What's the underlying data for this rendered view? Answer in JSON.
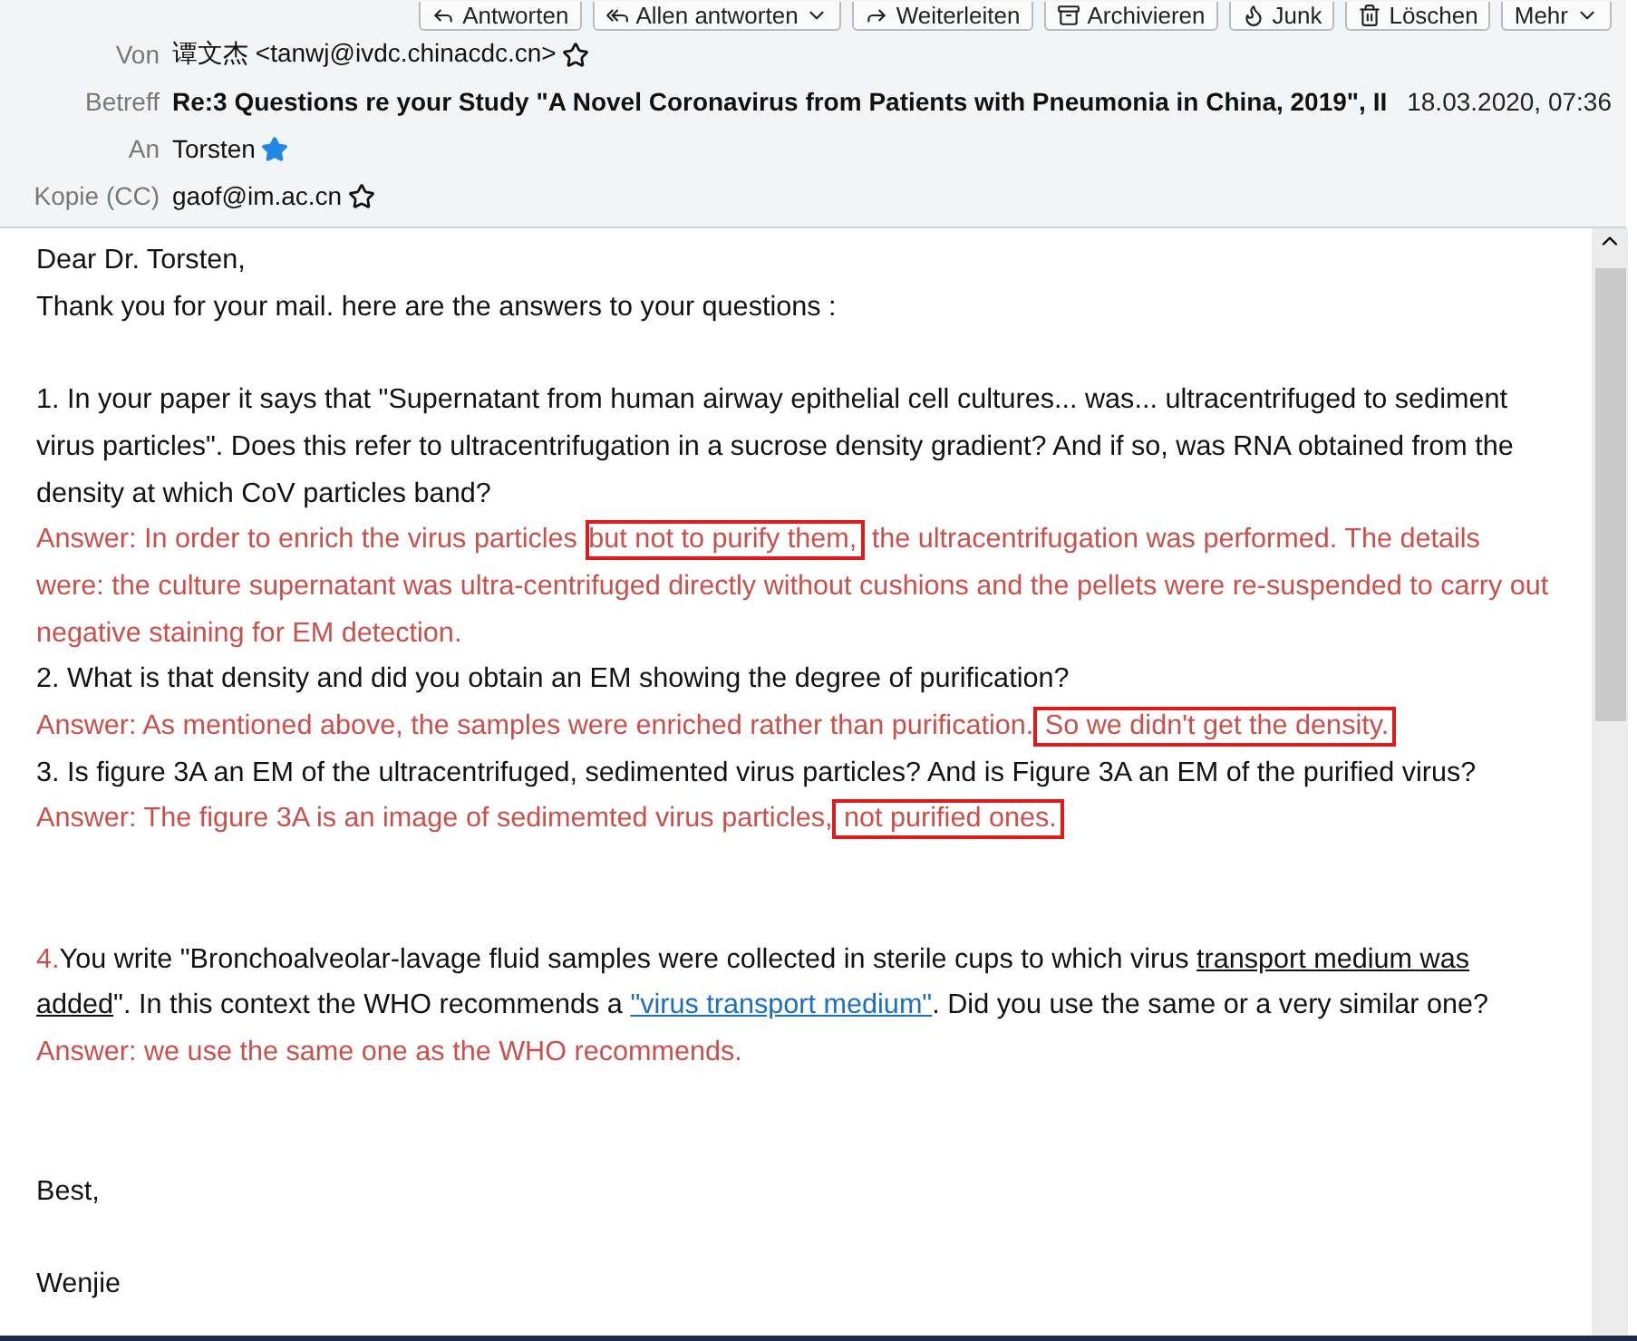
{
  "toolbar": [
    {
      "label": "Antworten",
      "dropdown": false
    },
    {
      "label": "Allen antworten",
      "dropdown": true
    },
    {
      "label": "Weiterleiten",
      "dropdown": false
    },
    {
      "label": "Archivieren",
      "dropdown": false
    },
    {
      "label": "Junk",
      "dropdown": false
    },
    {
      "label": "Löschen",
      "dropdown": false
    },
    {
      "label": "Mehr",
      "dropdown": true
    }
  ],
  "header": {
    "from": {
      "label": "Von",
      "value": "谭文杰 <tanwj@ivdc.chinacdc.cn>",
      "starred": false
    },
    "subject": {
      "label": "Betreff",
      "value": "Re:3 Questions re your Study \"A Novel Coronavirus from Patients with Pneumonia in China, 2019\", II",
      "date": "18.03.2020, 07:36"
    },
    "to": {
      "label": "An",
      "value": "Torsten",
      "starred": true
    },
    "cc": {
      "label": "Kopie (CC)",
      "value": "gaof@im.ac.cn",
      "starred": false
    }
  },
  "body": [
    {
      "kind": "paragraph",
      "parts": [
        {
          "text": "Dear Dr. Torsten,",
          "color": "#111111"
        }
      ]
    },
    {
      "kind": "paragraph",
      "parts": [
        {
          "text": "Thank you for your mail. here are the answers to your questions :",
          "color": "#111111"
        }
      ]
    },
    {
      "kind": "spacer"
    },
    {
      "kind": "paragraph",
      "parts": [
        {
          "text": "1. In your paper it says that \"Supernatant from human airway epithelial cell cultures... was... ultracentrifuged to sediment virus particles\". Does this refer to ultracentrifugation in a sucrose density gradient? And if so, was RNA obtained from the density at which CoV particles band?",
          "color": "#111111"
        }
      ]
    },
    {
      "kind": "paragraph",
      "parts": [
        {
          "text": "Answer: In order to enrich the virus particles ",
          "color": "#c9504b"
        },
        {
          "text": "but not to purify them,",
          "color": "#c9504b",
          "boxed": true
        },
        {
          "text": " the ultracentrifugation was performed. The details were: the culture supernatant was ultra-centrifuged directly without cushions and the pellets were re-suspended to carry out negative staining for EM detection.",
          "color": "#c9504b"
        }
      ]
    },
    {
      "kind": "paragraph",
      "parts": [
        {
          "text": "2. What is that density and did you obtain an EM showing the degree of purification?",
          "color": "#111111"
        }
      ]
    },
    {
      "kind": "paragraph",
      "parts": [
        {
          "text": "Answer: As mentioned above, the samples were enriched rather than purification.",
          "color": "#c9504b"
        },
        {
          "text": " So we didn't get the density.",
          "color": "#c9504b",
          "boxed": true
        }
      ]
    },
    {
      "kind": "paragraph",
      "parts": [
        {
          "text": "3. Is figure 3A an EM of the  ultracentrifuged, sedimented virus particles? And is Figure 3A an EM of the purified virus?",
          "color": "#111111"
        }
      ]
    },
    {
      "kind": "paragraph",
      "parts": [
        {
          "text": "Answer: The figure 3A is an image of sedimemted virus particles,",
          "color": "#c9504b"
        },
        {
          "text": " not purified ones.",
          "color": "#c9504b",
          "boxed": true
        }
      ]
    },
    {
      "kind": "spacer"
    },
    {
      "kind": "spacer"
    },
    {
      "kind": "paragraph",
      "parts": [
        {
          "text": "4.",
          "color": "#c9504b"
        },
        {
          "text": "You write \"Bronchoalveolar-lavage fluid samples were collected in sterile cups to which virus ",
          "color": "#111111"
        },
        {
          "text": "transport medium was added",
          "color": "#111111",
          "underline": true
        },
        {
          "text": "\". In this context the WHO recommends a ",
          "color": "#111111"
        },
        {
          "text": "\"virus transport medium\"",
          "color": "#1a6fbf",
          "link": true
        },
        {
          "text": ". Did you use the same or a very similar one?",
          "color": "#111111"
        }
      ]
    },
    {
      "kind": "paragraph",
      "parts": [
        {
          "text": "Answer: we use the same one  as the WHO recommends.",
          "color": "#c9504b"
        }
      ]
    },
    {
      "kind": "spacer"
    },
    {
      "kind": "spacer"
    },
    {
      "kind": "paragraph",
      "parts": [
        {
          "text": "Best,",
          "color": "#111111"
        }
      ]
    },
    {
      "kind": "spacer"
    },
    {
      "kind": "paragraph",
      "parts": [
        {
          "text": "Wenjie",
          "color": "#111111"
        }
      ]
    }
  ]
}
